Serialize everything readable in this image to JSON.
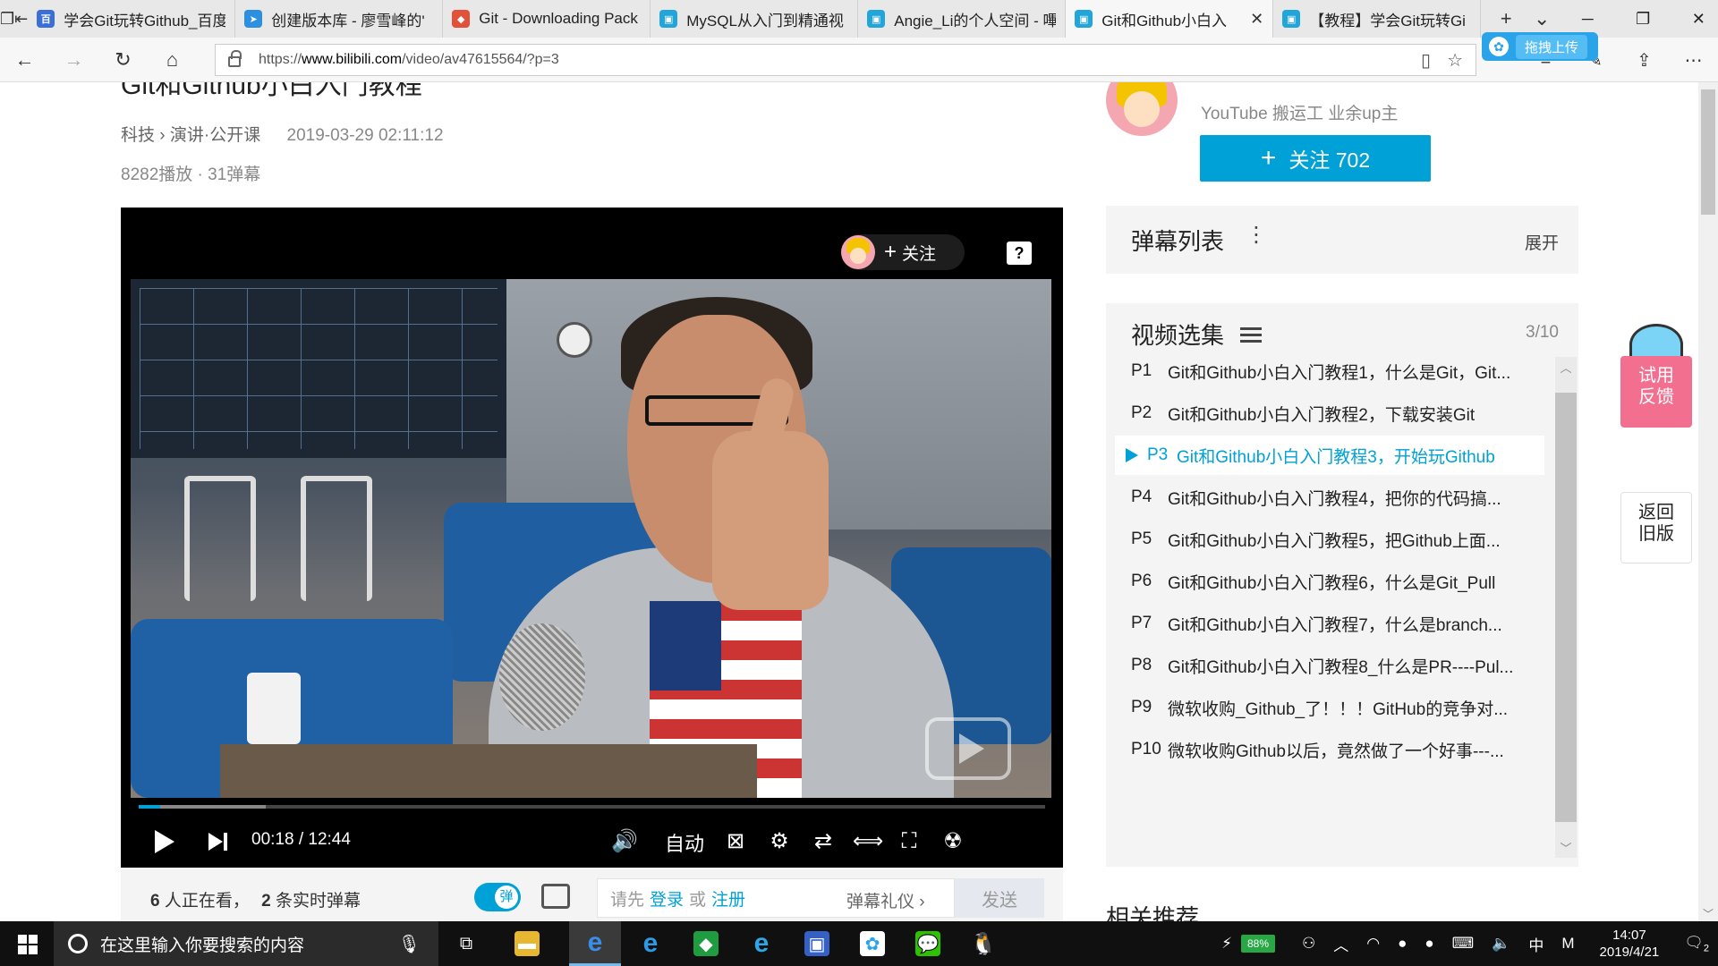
{
  "browser": {
    "tabs": [
      {
        "title": "学会Git玩转Github_百度",
        "fav_color": "#3a6fd8",
        "fav_glyph": "百"
      },
      {
        "title": "创建版本库 - 廖雪峰的'",
        "fav_color": "#2d8fe0",
        "fav_glyph": "➤"
      },
      {
        "title": "Git - Downloading Pack",
        "fav_color": "#e2523b",
        "fav_glyph": "◆"
      },
      {
        "title": "MySQL从入门到精通视",
        "fav_color": "#22a6d9",
        "fav_glyph": "▣"
      },
      {
        "title": "Angie_Li的个人空间 - 嗶",
        "fav_color": "#22a6d9",
        "fav_glyph": "▣"
      },
      {
        "title": "Git和Github小白入",
        "fav_color": "#22a6d9",
        "fav_glyph": "▣",
        "active": true
      },
      {
        "title": "【教程】学会Git玩转Gi",
        "fav_color": "#22a6d9",
        "fav_glyph": "▣"
      }
    ],
    "url_prefix": "https://",
    "url_host": "www.bilibili.com",
    "url_path": "/video/av47615564/?p=3",
    "upload_badge": "拖拽上传"
  },
  "video": {
    "title": "Git和Github小白入门教程",
    "category": "科技 › 演讲·公开课",
    "date": "2019-03-29 02:11:12",
    "stats": "8282播放 · 31弹幕"
  },
  "owner": {
    "desc": "YouTube 搬运工 业余up主",
    "follow_label": "关注 702"
  },
  "player": {
    "follow_label": "关注",
    "help": "?",
    "current_time": "00:18",
    "separator": "/",
    "duration": "12:44",
    "auto_label": "自动",
    "played_fraction": 0.024,
    "buffered_fraction": 0.14
  },
  "danmaku_bar": {
    "watching_count": "6",
    "watching_text": "人正在看，",
    "live_count": "2",
    "live_text": "条实时弹幕",
    "toggle_glyph": "弹",
    "input_prefix": "请先",
    "login": "登录",
    "or": "或",
    "register": "注册",
    "gift": "弹幕礼仪 ›",
    "send": "发送"
  },
  "danmu_list": {
    "title": "弹幕列表",
    "expand": "展开"
  },
  "episodes": {
    "title": "视频选集",
    "count": "3/10",
    "items": [
      {
        "p": "P1",
        "name": "Git和Github小白入门教程1，什么是Git，Git..."
      },
      {
        "p": "P2",
        "name": "Git和Github小白入门教程2，下载安装Git"
      },
      {
        "p": "P3",
        "name": "Git和Github小白入门教程3，开始玩Github",
        "active": true
      },
      {
        "p": "P4",
        "name": "Git和Github小白入门教程4，把你的代码搞..."
      },
      {
        "p": "P5",
        "name": "Git和Github小白入门教程5，把Github上面..."
      },
      {
        "p": "P6",
        "name": "Git和Github小白入门教程6，什么是Git_Pull"
      },
      {
        "p": "P7",
        "name": "Git和Github小白入门教程7，什么是branch..."
      },
      {
        "p": "P8",
        "name": "Git和Github小白入门教程8_什么是PR----Pul..."
      },
      {
        "p": "P9",
        "name": "微软收购_Github_了！！！GitHub的竞争对..."
      },
      {
        "p": "P10",
        "name": "微软收购Github以后，竟然做了一个好事---..."
      }
    ]
  },
  "related_title": "相关推荐",
  "side": {
    "feedback": "试用\n反馈",
    "old_version": "返回\n旧版"
  },
  "taskbar": {
    "search_placeholder": "在这里输入你要搜索的内容",
    "battery": "88%",
    "ime": "中",
    "ime2": "M",
    "time": "14:07",
    "date": "2019/4/21",
    "notifications": "2"
  }
}
